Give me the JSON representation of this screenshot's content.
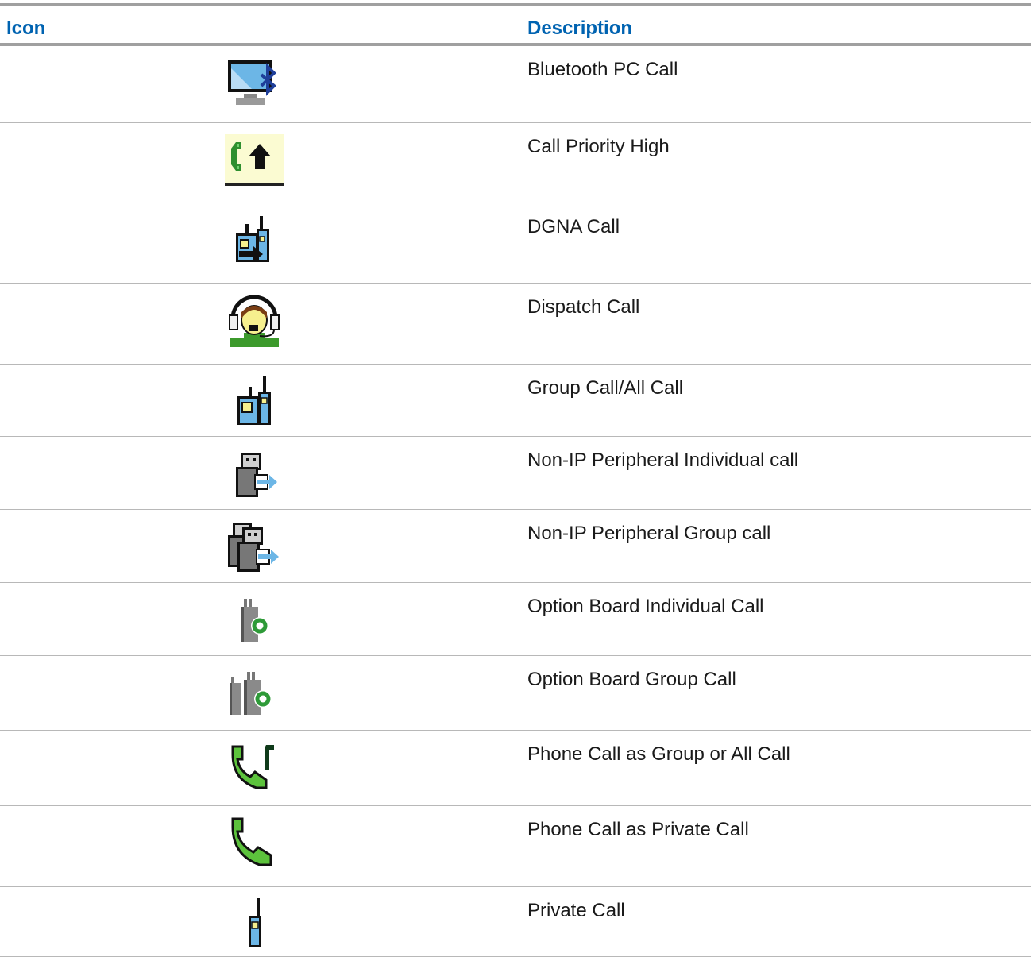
{
  "table": {
    "header": {
      "icon": "Icon",
      "description": "Description"
    },
    "rows": [
      {
        "icon": "bluetooth-pc-call-icon",
        "description": "Bluetooth PC Call"
      },
      {
        "icon": "call-priority-high-icon",
        "description": "Call Priority High"
      },
      {
        "icon": "dgna-call-icon",
        "description": "DGNA Call"
      },
      {
        "icon": "dispatch-call-icon",
        "description": "Dispatch Call"
      },
      {
        "icon": "group-call-icon",
        "description": "Group Call/All Call"
      },
      {
        "icon": "non-ip-peripheral-individual-call-icon",
        "description": "Non-IP Peripheral Individual call"
      },
      {
        "icon": "non-ip-peripheral-group-call-icon",
        "description": "Non-IP Peripheral Group call"
      },
      {
        "icon": "option-board-individual-call-icon",
        "description": "Option Board Individual Call"
      },
      {
        "icon": "option-board-group-call-icon",
        "description": "Option Board Group Call"
      },
      {
        "icon": "phone-call-group-icon",
        "description": "Phone Call as Group or All Call"
      },
      {
        "icon": "phone-call-private-icon",
        "description": "Phone Call as Private Call"
      },
      {
        "icon": "private-call-icon",
        "description": "Private Call"
      }
    ]
  },
  "colors": {
    "header_text": "#0063b1",
    "rule": "#a0a0a0",
    "row_divider": "#b8b8b8"
  }
}
